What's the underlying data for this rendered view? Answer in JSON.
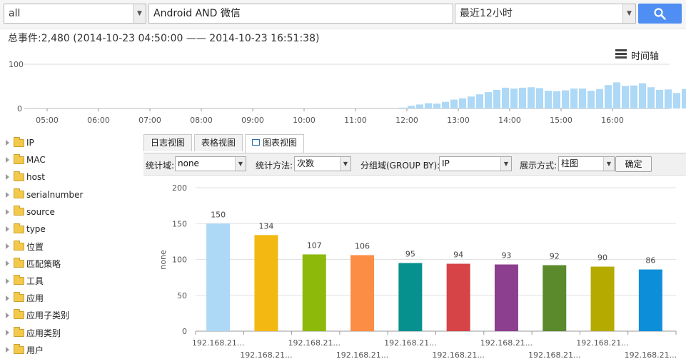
{
  "search": {
    "source_value": "all",
    "query_value": "Android AND 微信",
    "time_range": "最近12小时"
  },
  "summary": "总事件:2,480 (2014-10-23 04:50:00 —— 2014-10-23 16:51:38)",
  "timeline_label": "时间轴",
  "histogram": {
    "y_ticks": [
      "100",
      "0"
    ],
    "x_ticks": [
      "05:00",
      "06:00",
      "07:00",
      "08:00",
      "09:00",
      "10:00",
      "11:00",
      "12:00",
      "13:00",
      "14:00",
      "15:00",
      "16:00"
    ],
    "bar_color": "#add8f6",
    "values": [
      0,
      0,
      0,
      0,
      0,
      0,
      0,
      0,
      0,
      0,
      0,
      0,
      0,
      0,
      0,
      0,
      0,
      0,
      0,
      0,
      0,
      0,
      0,
      0,
      0,
      0,
      0,
      0,
      0,
      0,
      0,
      0,
      0,
      0,
      0,
      0,
      0,
      0,
      0,
      0,
      0,
      0,
      2,
      6,
      9,
      12,
      11,
      15,
      20,
      23,
      27,
      32,
      37,
      42,
      47,
      45,
      47,
      48,
      46,
      40,
      39,
      41,
      45,
      45,
      40,
      44,
      53,
      59,
      51,
      52,
      57,
      48,
      42,
      43,
      35,
      44,
      44,
      57,
      56,
      57,
      70,
      58,
      46,
      56,
      52,
      50,
      64,
      60,
      64,
      48,
      53,
      63,
      58,
      58,
      61,
      52,
      64,
      64,
      58,
      61,
      68,
      44
    ]
  },
  "tree": {
    "items": [
      "IP",
      "MAC",
      "host",
      "serialnumber",
      "source",
      "type",
      "位置",
      "匹配策略",
      "工具",
      "应用",
      "应用子类别",
      "应用类别",
      "用户"
    ]
  },
  "tabs": [
    "日志视图",
    "表格视图",
    "图表视图"
  ],
  "options": {
    "field_label": "统计域:",
    "field_value": "none",
    "method_label": "统计方法:",
    "method_value": "次数",
    "group_label": "分组域(GROUP BY):",
    "group_value": "IP",
    "display_label": "展示方式:",
    "display_value": "柱图",
    "ok_label": "确定"
  },
  "chart_data": {
    "type": "bar",
    "ylabel": "none",
    "ylim": [
      0,
      200
    ],
    "y_ticks": [
      "0",
      "50",
      "100",
      "150",
      "200"
    ],
    "categories": [
      "192.168.21...",
      "192.168.21...",
      "192.168.21...",
      "192.168.21...",
      "192.168.21...",
      "192.168.21...",
      "192.168.21...",
      "192.168.21...",
      "192.168.21...",
      "192.168.21..."
    ],
    "values": [
      150,
      134,
      107,
      106,
      95,
      94,
      93,
      92,
      90,
      86
    ],
    "colors": [
      "#add8f6",
      "#f3b912",
      "#8cb90a",
      "#fc8d44",
      "#07918e",
      "#d64448",
      "#8c3f8e",
      "#5a8a2c",
      "#b5aa00",
      "#0c8ed9"
    ],
    "grid": true,
    "legend": "none"
  }
}
